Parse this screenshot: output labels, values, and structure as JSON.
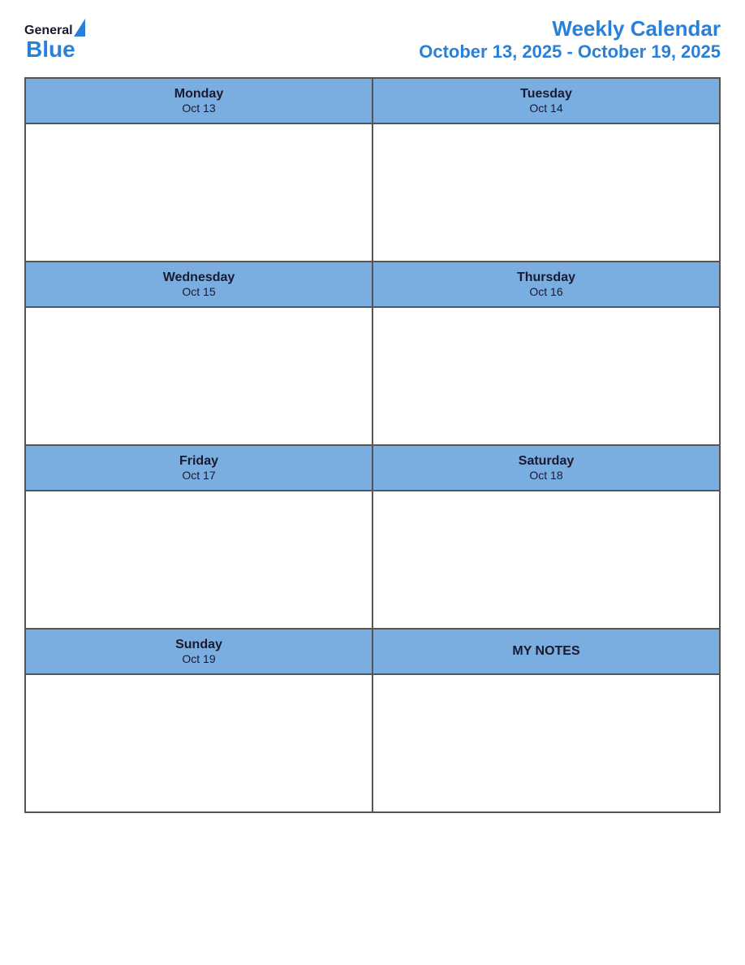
{
  "header": {
    "logo_general": "General",
    "logo_blue": "Blue",
    "title_main": "Weekly Calendar",
    "title_date": "October 13, 2025 - October 19, 2025"
  },
  "calendar": {
    "rows": [
      {
        "type": "header-row",
        "cells": [
          {
            "day": "Monday",
            "date": "Oct 13"
          },
          {
            "day": "Tuesday",
            "date": "Oct 14"
          }
        ]
      },
      {
        "type": "body-row",
        "cells": [
          "",
          ""
        ]
      },
      {
        "type": "header-row",
        "cells": [
          {
            "day": "Wednesday",
            "date": "Oct 15"
          },
          {
            "day": "Thursday",
            "date": "Oct 16"
          }
        ]
      },
      {
        "type": "body-row",
        "cells": [
          "",
          ""
        ]
      },
      {
        "type": "header-row",
        "cells": [
          {
            "day": "Friday",
            "date": "Oct 17"
          },
          {
            "day": "Saturday",
            "date": "Oct 18"
          }
        ]
      },
      {
        "type": "body-row",
        "cells": [
          "",
          ""
        ]
      },
      {
        "type": "header-row-mixed",
        "cells": [
          {
            "day": "Sunday",
            "date": "Oct 19"
          },
          {
            "type": "notes",
            "label": "MY NOTES"
          }
        ]
      },
      {
        "type": "body-row",
        "cells": [
          "",
          ""
        ]
      }
    ],
    "days": [
      {
        "name": "Monday",
        "date": "Oct 13"
      },
      {
        "name": "Tuesday",
        "date": "Oct 14"
      },
      {
        "name": "Wednesday",
        "date": "Oct 15"
      },
      {
        "name": "Thursday",
        "date": "Oct 16"
      },
      {
        "name": "Friday",
        "date": "Oct 17"
      },
      {
        "name": "Saturday",
        "date": "Oct 18"
      },
      {
        "name": "Sunday",
        "date": "Oct 19"
      }
    ],
    "notes_label": "MY NOTES"
  }
}
